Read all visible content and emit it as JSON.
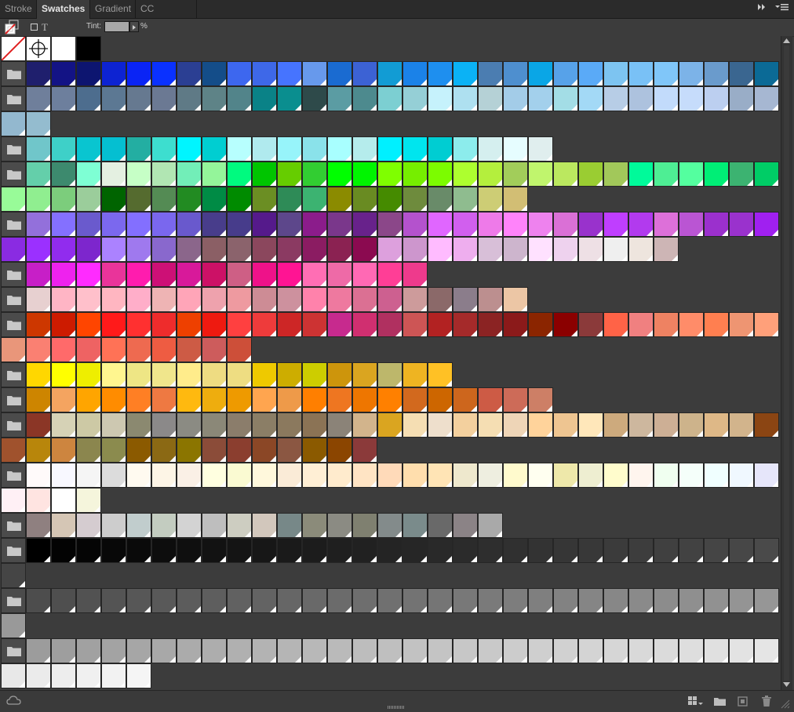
{
  "tabs": [
    {
      "label": "Stroke",
      "active": false
    },
    {
      "label": "Swatches",
      "active": true
    },
    {
      "label": "Gradient",
      "active": false
    },
    {
      "label": "CC Libraries",
      "active": false
    }
  ],
  "toolbar": {
    "tint_label": "Tint:",
    "tint_unit": "%",
    "text_glyph": "T"
  },
  "rows": [
    {
      "folder": false,
      "colors": [
        "none",
        "registration",
        "#ffffff",
        "#000000"
      ]
    },
    {
      "folder": true,
      "colors": [
        "#1f1f6d",
        "#131385",
        "#0d1570",
        "#0d23d2",
        "#0a24f5",
        "#0a31ff",
        "#2b3f93",
        "#144d89",
        "#3d67ef",
        "#3e68e8",
        "#4674ff",
        "#6799ec",
        "#1a6bd1",
        "#3c62d4",
        "#129cd4",
        "#1b82e8",
        "#1e8fef",
        "#0bb2f5",
        "#4b7db1",
        "#4e8fcf",
        "#0aa6e6",
        "#57a2e9",
        "#5aaaf7",
        "#7dc4f1",
        "#79c1f6",
        "#80c6f9",
        "#7cb3e8",
        "#6a9bcc",
        "#3a6690",
        "#0b6a96"
      ]
    },
    {
      "folder": true,
      "colors": [
        "#6f7f9b",
        "#6d7f9d",
        "#4d6d8e",
        "#5c7893",
        "#667990",
        "#6b7993",
        "#5f7a86",
        "#5e8387",
        "#52848a",
        "#0a8287",
        "#0a8e8f",
        "#2e4a4a",
        "#5b9ca3",
        "#4d8a8e",
        "#7ccfd2",
        "#95cfd6",
        "#c6f2fc",
        "#aee0f0",
        "#b5d1d6",
        "#a3cce8",
        "#a3d0ec",
        "#a3dde6",
        "#a3d9f6",
        "#b7cde6",
        "#adc2de",
        "#c2dbfb",
        "#c6dcfb",
        "#bccff0",
        "#99adc7",
        "#a6b7d2"
      ]
    },
    {
      "folder": false,
      "colors": [
        "#93b8cf",
        "#94bccf"
      ]
    },
    {
      "folder": true,
      "colors": [
        "#70c6ca",
        "#3ed0c8",
        "#09c5d0",
        "#05bfd1",
        "#23aea2",
        "#3ddecf",
        "#00f5ff",
        "#00ced1",
        "#b7fffe",
        "#b0eaee",
        "#97f4fa",
        "#8ae2ea",
        "#a8ffff",
        "#b5ecec",
        "#00f0ff",
        "#00e5ee",
        "#00cdd2",
        "#8cecec",
        "#d5efef",
        "#e6fdff",
        "#e0eeee"
      ]
    },
    {
      "folder": true,
      "colors": [
        "#64cfaa",
        "#3d8a6e",
        "#7effd4",
        "#e4f0e1",
        "#c6ffc6",
        "#b1e6b3",
        "#72eeb8",
        "#94f59a",
        "#00fa7f",
        "#00c500",
        "#66cd00",
        "#32cd32",
        "#00ff00",
        "#00f500",
        "#7fff00",
        "#76ee00",
        "#7cfc00",
        "#adff2f",
        "#b4ef3d",
        "#a2cd5a",
        "#c0f56d",
        "#bbe85f",
        "#9acd32",
        "#a2c85a",
        "#00fa9a",
        "#4eee94",
        "#54ff9f",
        "#00ee76",
        "#3cb371",
        "#00cd66"
      ]
    },
    {
      "folder": false,
      "colors": [
        "#98fb98",
        "#90ee90",
        "#7ccd7c",
        "#9bcd9b",
        "#006400",
        "#556b2f",
        "#548b54",
        "#228b22",
        "#008b45",
        "#008b00",
        "#6b8e23",
        "#2e8b57",
        "#3cb371",
        "#8b8b00",
        "#698b22",
        "#458b00",
        "#6e8b3d",
        "#698b69",
        "#8fbc8f",
        "#cdcd75",
        "#d2be74"
      ]
    },
    {
      "folder": true,
      "colors": [
        "#9370db",
        "#8470ff",
        "#6a5acd",
        "#7b68ee",
        "#836fff",
        "#7a67ee",
        "#6959cd",
        "#483d8b",
        "#473c8b",
        "#551a8b",
        "#5d478b",
        "#8b1c8b",
        "#7a378b",
        "#68228b",
        "#8b4789",
        "#b452cd",
        "#e066ff",
        "#d15fee",
        "#ee7ae9",
        "#ff83fa",
        "#ee82ee",
        "#da70d6",
        "#9932cc",
        "#bf3eff",
        "#b23aee",
        "#dd70d9",
        "#ba55d3",
        "#9b30cd",
        "#9a32cd",
        "#a020f0"
      ]
    },
    {
      "folder": false,
      "colors": [
        "#8a2be2",
        "#9b30ff",
        "#912cee",
        "#7d26cd",
        "#ab82ff",
        "#9f79ee",
        "#8968cd",
        "#8b668b",
        "#8b5f65",
        "#8b636c",
        "#8b475d",
        "#8b3a62",
        "#8b1c62",
        "#8b2252",
        "#8b0a50",
        "#dda0dd",
        "#cd96cd",
        "#ffbbff",
        "#eeaeee",
        "#d8bfd8",
        "#cdb5cd",
        "#ffe1ff",
        "#eed2ee",
        "#eee0e5",
        "#efefef",
        "#eee5de",
        "#cdb5b5"
      ]
    },
    {
      "folder": true,
      "colors": [
        "#c71fc7",
        "#ee22ee",
        "#ff2bff",
        "#e9349a",
        "#ff1cae",
        "#cd1076",
        "#d8199a",
        "#cc1166",
        "#ce5f85",
        "#ee1289",
        "#ff1493",
        "#ff6eb4",
        "#ee6aa7",
        "#ff69b4",
        "#ff3e96",
        "#ee3a8c"
      ]
    },
    {
      "folder": true,
      "colors": [
        "#e7d0d0",
        "#ffb5c5",
        "#ffc0cb",
        "#ffb6c1",
        "#ffaec9",
        "#eeb4b4",
        "#ffa5b8",
        "#eea2ad",
        "#ee9aa0",
        "#cd8c95",
        "#cd919e",
        "#ff82ab",
        "#ee799f",
        "#db7093",
        "#cd6090",
        "#cd9b9b",
        "#8b6969",
        "#8b7d8b",
        "#bc8f8f",
        "#ecc6a5"
      ]
    },
    {
      "folder": true,
      "colors": [
        "#cd3700",
        "#cd1b00",
        "#ff4500",
        "#ff1a1a",
        "#ff3030",
        "#ee2c2c",
        "#ee4000",
        "#ee1a10",
        "#ff4040",
        "#ee3b3b",
        "#cd2626",
        "#cd3333",
        "#c72a8e",
        "#d02f70",
        "#b03060",
        "#cd5555",
        "#b22222",
        "#a52a2a",
        "#8b2323",
        "#8b1a1a",
        "#8b2500",
        "#8b0000",
        "#8b3a3a",
        "#ff6347",
        "#f08080",
        "#ee8262",
        "#ff8c69",
        "#ff7f50",
        "#ee9572",
        "#ffa07a"
      ]
    },
    {
      "folder": false,
      "colors": [
        "#e9967a",
        "#fa8072",
        "#ff6a6a",
        "#ee6363",
        "#ff7256",
        "#ee6a50",
        "#ee5c42",
        "#cd5b45",
        "#cd5c5c",
        "#cd4f39"
      ]
    },
    {
      "folder": true,
      "colors": [
        "#ffd700",
        "#ffff00",
        "#eeee00",
        "#fff68f",
        "#eee685",
        "#f0e68c",
        "#ffec8b",
        "#eedc82",
        "#eedd82",
        "#eec900",
        "#cdad00",
        "#cdcd00",
        "#cd950c",
        "#daa520",
        "#bdb76b",
        "#eeb422",
        "#ffc125"
      ]
    },
    {
      "folder": true,
      "colors": [
        "#cd8500",
        "#f4a460",
        "#ffa500",
        "#ff8c00",
        "#ff7f24",
        "#ee7942",
        "#ffb90f",
        "#eead0e",
        "#ee9a00",
        "#ffa54f",
        "#ee9a49",
        "#ff7f00",
        "#ee7621",
        "#ee7600",
        "#ff8000",
        "#d2691e",
        "#cd6600",
        "#cd661d",
        "#cd5b45",
        "#cd6b58",
        "#cd7f66"
      ]
    },
    {
      "folder": true,
      "colors": [
        "#8b3626",
        "#d6d2b6",
        "#cdc9a5",
        "#cdc8b1",
        "#8b8970",
        "#8b8989",
        "#8b8b83",
        "#8b8878",
        "#8b7d6b",
        "#8b7e66",
        "#8b795e",
        "#8b7355",
        "#8b8378",
        "#d2b48c",
        "#daa520",
        "#f5deb3",
        "#eedfcc",
        "#f3d09e",
        "#f5deb3",
        "#eed5b7",
        "#ffd39b",
        "#eec591",
        "#ffe7ba",
        "#cdaa7d",
        "#cdb79e",
        "#cdaf95",
        "#cdb38b",
        "#deb887",
        "#d2b48c",
        "#8b4513"
      ]
    },
    {
      "folder": false,
      "colors": [
        "#a0522d",
        "#b8860b",
        "#cd853f",
        "#8b864e",
        "#8b8b4e",
        "#8b5a00",
        "#8b6914",
        "#8b7500",
        "#8b4c39",
        "#8b3e2f",
        "#8b4726",
        "#8b5742",
        "#8b5a00",
        "#8b4500",
        "#8b3a3a"
      ]
    },
    {
      "folder": true,
      "colors": [
        "#fffafa",
        "#f8f8ff",
        "#f5f5f5",
        "#dcdcdc",
        "#fffaf0",
        "#fdf5e6",
        "#faf0e6",
        "#ffffe0",
        "#fafad2",
        "#fff8dc",
        "#faebd7",
        "#ffefd5",
        "#ffebcd",
        "#ffe4c4",
        "#ffdab9",
        "#ffdead",
        "#ffe4b5",
        "#eee8cd",
        "#eeeee0",
        "#fffacd",
        "#fffff0",
        "#eee8aa",
        "#eeeed1",
        "#fffccc",
        "#fff5ee",
        "#f0fff0",
        "#f5fffa",
        "#f0ffff",
        "#f0f8ff",
        "#e6e6fa"
      ]
    },
    {
      "folder": false,
      "colors": [
        "#fff0f5",
        "#ffe4e1",
        "#ffffff",
        "#f5f5dc"
      ]
    },
    {
      "folder": true,
      "colors": [
        "#8f8080",
        "#d5c6b5",
        "#d5ccd0",
        "#cdcdcd",
        "#c1cdcd",
        "#c3ccc0",
        "#d3d3d3",
        "#bebebe",
        "#cdcdc1",
        "#d2c7bc",
        "#778888",
        "#8b8b7a",
        "#8b8b83",
        "#7f8070",
        "#838b8b",
        "#7a8b8b",
        "#696969",
        "#8b8386",
        "#a9a9a9"
      ]
    },
    {
      "folder": true,
      "colors": [
        "#000000",
        "#030303",
        "#050505",
        "#080808",
        "#0a0a0a",
        "#0d0d0d",
        "#0f0f0f",
        "#121212",
        "#141414",
        "#171717",
        "#1a1a1a",
        "#1c1c1c",
        "#1f1f1f",
        "#212121",
        "#242424",
        "#262626",
        "#292929",
        "#2b2b2b",
        "#2e2e2e",
        "#303030",
        "#333333",
        "#363636",
        "#383838",
        "#3b3b3b",
        "#3d3d3d",
        "#404040",
        "#424242",
        "#454545",
        "#474747",
        "#4a4a4a"
      ]
    },
    {
      "folder": false,
      "colors": [
        "#454545"
      ]
    },
    {
      "folder": true,
      "colors": [
        "#4d4d4d",
        "#4f4f4f",
        "#525252",
        "#545454",
        "#575757",
        "#595959",
        "#5c5c5c",
        "#5e5e5e",
        "#616161",
        "#636363",
        "#666666",
        "#696969",
        "#6b6b6b",
        "#6e6e6e",
        "#707070",
        "#737373",
        "#757575",
        "#787878",
        "#7a7a7a",
        "#7d7d7d",
        "#7f7f7f",
        "#828282",
        "#858585",
        "#878787",
        "#8a8a8a",
        "#8c8c8c",
        "#8f8f8f",
        "#919191",
        "#949494",
        "#969696"
      ]
    },
    {
      "folder": false,
      "colors": [
        "#999999"
      ]
    },
    {
      "folder": true,
      "colors": [
        "#9c9c9c",
        "#9e9e9e",
        "#a1a1a1",
        "#a3a3a3",
        "#a6a6a6",
        "#a8a8a8",
        "#ababab",
        "#adadad",
        "#b0b0b0",
        "#b3b3b3",
        "#b5b5b5",
        "#b8b8b8",
        "#bababa",
        "#bdbdbd",
        "#bfbfbf",
        "#c2c2c2",
        "#c4c4c4",
        "#c7c7c7",
        "#c9c9c9",
        "#cccccc",
        "#cfcfcf",
        "#d1d1d1",
        "#d4d4d4",
        "#d6d6d6",
        "#d9d9d9",
        "#dbdbdb",
        "#dedede",
        "#e0e0e0",
        "#e3e3e3",
        "#e5e5e5"
      ]
    },
    {
      "folder": false,
      "colors": [
        "#e8e8e8",
        "#ebebeb",
        "#ededed",
        "#f0f0f0",
        "#f2f2f2",
        "#f5f5f5"
      ]
    }
  ]
}
